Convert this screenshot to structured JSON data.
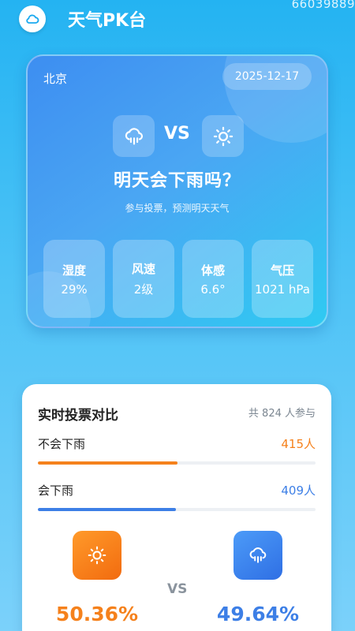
{
  "watermark": "66039889",
  "app": {
    "title": "天气PK台",
    "logo_icon": "cloud-icon"
  },
  "weather": {
    "city": "北京",
    "date": "2025-12-17",
    "left_icon": "rain-cloud-icon",
    "right_icon": "sun-icon",
    "vs": "VS",
    "question": "明天会下雨吗？",
    "subtitle": "参与投票，预测明天天气",
    "stats": [
      {
        "label": "湿度",
        "value": "29%"
      },
      {
        "label": "风速",
        "value": "2级"
      },
      {
        "label": "体感",
        "value": "6.6°"
      },
      {
        "label": "气压",
        "value": "1021 hPa"
      }
    ]
  },
  "vote": {
    "title": "实时投票对比",
    "total": "共 824 人参与",
    "options": [
      {
        "label": "不会下雨",
        "count": "415人",
        "fraction": 0.5036,
        "color": "#f5811c"
      },
      {
        "label": "会下雨",
        "count": "409人",
        "fraction": 0.4964,
        "color": "#3d7fe6"
      }
    ],
    "vs": "VS",
    "no_rain_icon": "sun-icon",
    "rain_icon": "rain-cloud-icon",
    "no_rain_percent": "50.36%",
    "rain_percent": "49.64%"
  }
}
